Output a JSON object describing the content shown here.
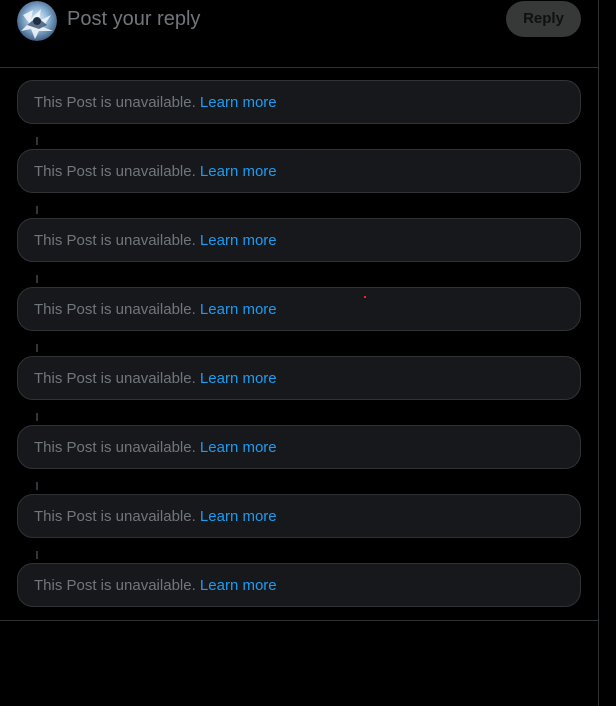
{
  "reply_composer": {
    "placeholder": "Post your reply",
    "button_label": "Reply",
    "avatar_icon": "user-avatar-icon"
  },
  "posts": [
    {
      "text": "This Post is unavailable.",
      "link": "Learn more"
    },
    {
      "text": "This Post is unavailable.",
      "link": "Learn more"
    },
    {
      "text": "This Post is unavailable.",
      "link": "Learn more"
    },
    {
      "text": "This Post is unavailable.",
      "link": "Learn more"
    },
    {
      "text": "This Post is unavailable.",
      "link": "Learn more"
    },
    {
      "text": "This Post is unavailable.",
      "link": "Learn more"
    },
    {
      "text": "This Post is unavailable.",
      "link": "Learn more"
    },
    {
      "text": "This Post is unavailable.",
      "link": "Learn more"
    }
  ],
  "colors": {
    "background": "#000000",
    "card": "#16181c",
    "border": "#2f3336",
    "muted_text": "#71767b",
    "link": "#1d9bf0"
  }
}
